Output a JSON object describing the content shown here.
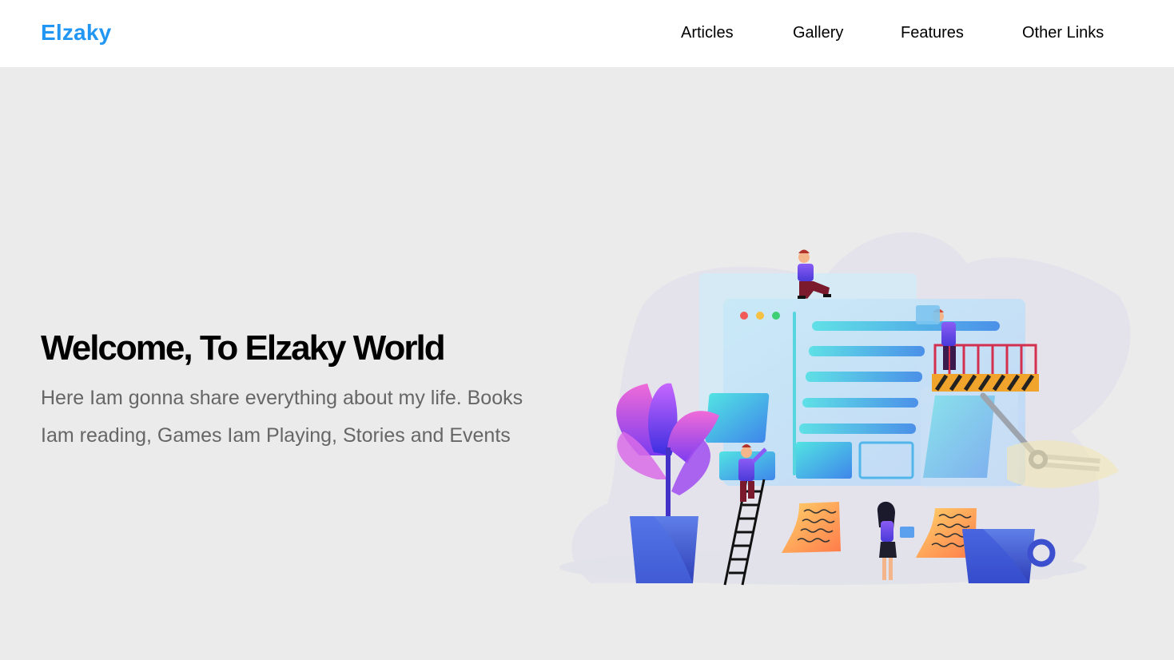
{
  "header": {
    "logo": "Elzaky",
    "nav": [
      {
        "label": "Articles"
      },
      {
        "label": "Gallery"
      },
      {
        "label": "Features"
      },
      {
        "label": "Other Links"
      }
    ]
  },
  "hero": {
    "title": "Welcome, To Elzaky World",
    "description": "Here Iam gonna share everything about my life. Books Iam reading, Games Iam Playing, Stories and Events"
  },
  "colors": {
    "brand": "#2196f3",
    "background": "#ebebeb",
    "header_bg": "#ffffff",
    "text_dark": "#000000",
    "text_muted": "#666666"
  },
  "illustration": {
    "icon": "website-building-illustration"
  }
}
